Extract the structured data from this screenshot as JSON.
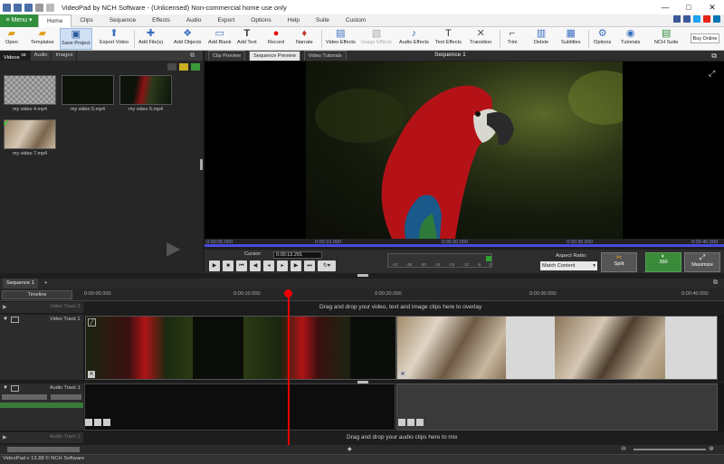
{
  "window": {
    "title": "VideoPad by NCH Software - (Unlicensed) Non-commercial home use only",
    "controls": [
      "—",
      "□",
      "✕"
    ]
  },
  "menu": {
    "button": "≡ Menu ▾",
    "tabs": [
      "Home",
      "Clips",
      "Sequence",
      "Effects",
      "Audio",
      "Export",
      "Options",
      "Help",
      "Suite",
      "Custom"
    ],
    "active_tab": "Home"
  },
  "toolbar": {
    "buttons": [
      {
        "label": "Open",
        "icon": "open-folder-icon",
        "glyph": "📂"
      },
      {
        "label": "Templates",
        "icon": "templates-icon",
        "glyph": "🗂"
      },
      {
        "label": "Save Project",
        "icon": "save-icon",
        "glyph": "💾"
      },
      {
        "label": "Export Video",
        "icon": "export-video-icon",
        "glyph": "⤴"
      },
      {
        "label": "Add File(s)",
        "icon": "add-files-icon",
        "glyph": "➕"
      },
      {
        "label": "Add Objects",
        "icon": "add-objects-icon",
        "glyph": "❖"
      },
      {
        "label": "Add Blank",
        "icon": "add-blank-icon",
        "glyph": "▭"
      },
      {
        "label": "Add Text",
        "icon": "add-text-icon",
        "glyph": "T"
      },
      {
        "label": "Record",
        "icon": "record-icon",
        "glyph": "●"
      },
      {
        "label": "Narrate",
        "icon": "narrate-microphone-icon",
        "glyph": "🎙"
      },
      {
        "label": "Video Effects",
        "icon": "video-effects-icon",
        "glyph": "🎞"
      },
      {
        "label": "Image Effects",
        "icon": "image-effects-icon",
        "glyph": "🖼"
      },
      {
        "label": "Audio Effects",
        "icon": "audio-effects-icon",
        "glyph": "♪"
      },
      {
        "label": "Text Effects",
        "icon": "text-effects-icon",
        "glyph": "T"
      },
      {
        "label": "Transition",
        "icon": "transition-icon",
        "glyph": "✕"
      },
      {
        "label": "Trim",
        "icon": "trim-icon",
        "glyph": "⌐"
      },
      {
        "label": "Delete",
        "icon": "delete-icon",
        "glyph": "🗑"
      },
      {
        "label": "Subtitles",
        "icon": "subtitles-icon",
        "glyph": "▦"
      },
      {
        "label": "Options",
        "icon": "options-gear-icon",
        "glyph": "⚙"
      },
      {
        "label": "Tutorials",
        "icon": "tutorials-icon",
        "glyph": "◉"
      },
      {
        "label": "NCH Suite",
        "icon": "nch-suite-icon",
        "glyph": "▤"
      }
    ],
    "buy_online": "Buy Online"
  },
  "bin": {
    "tabs": [
      "Videos",
      "Audio",
      "Images"
    ],
    "videos_count": "26",
    "clips": [
      {
        "name": "my video 4.mp4"
      },
      {
        "name": "my video 5.mp4"
      },
      {
        "name": "my video 6.mp4"
      },
      {
        "name": "my video 7.mp4"
      }
    ]
  },
  "preview": {
    "tabs": [
      "Clip Preview",
      "Sequence Preview",
      "Video Tutorials"
    ],
    "active_tab": "Sequence Preview",
    "sequence_title": "Sequence 1",
    "ruler": [
      "0:00:00.000",
      "0:00:10.000",
      "0:00:20.000",
      "0:00:30.000",
      "0:00:40.000"
    ],
    "cursor_label": "Cursor:",
    "cursor_value": "0:00:13.291",
    "meter_ticks": [
      "-42",
      "-36",
      "-30",
      "-24",
      "-18",
      "-12",
      "-6",
      "0"
    ],
    "aspect_label": "Aspect Ratio:",
    "aspect_value": "Match Content",
    "split": "Split",
    "view360": "360",
    "maximize": "Maximize"
  },
  "timeline": {
    "tabs": [
      "Sequence 1",
      "+"
    ],
    "view_mode": "Timeline",
    "ruler": [
      "0:00:00.000",
      "0:00:10.000",
      "0:00:20.000",
      "0:00:30.000",
      "0:00:40.000"
    ],
    "tracks": {
      "video_overlay": "Video Track 2",
      "video": "Video Track 1",
      "audio": "Audio Track 1",
      "audio_overlay": "Audio Track 2"
    },
    "video_drop_hint": "Drag and drop your video, text and image clips here to overlay",
    "audio_drop_hint": "Drag and drop your audio clips here to mix"
  },
  "status": "VideoPad v 13.88 © NCH Software",
  "colors": {
    "accent_green": "#2f8f3a",
    "ruler_blue": "#4a4ae0",
    "playhead": "#e00000"
  }
}
